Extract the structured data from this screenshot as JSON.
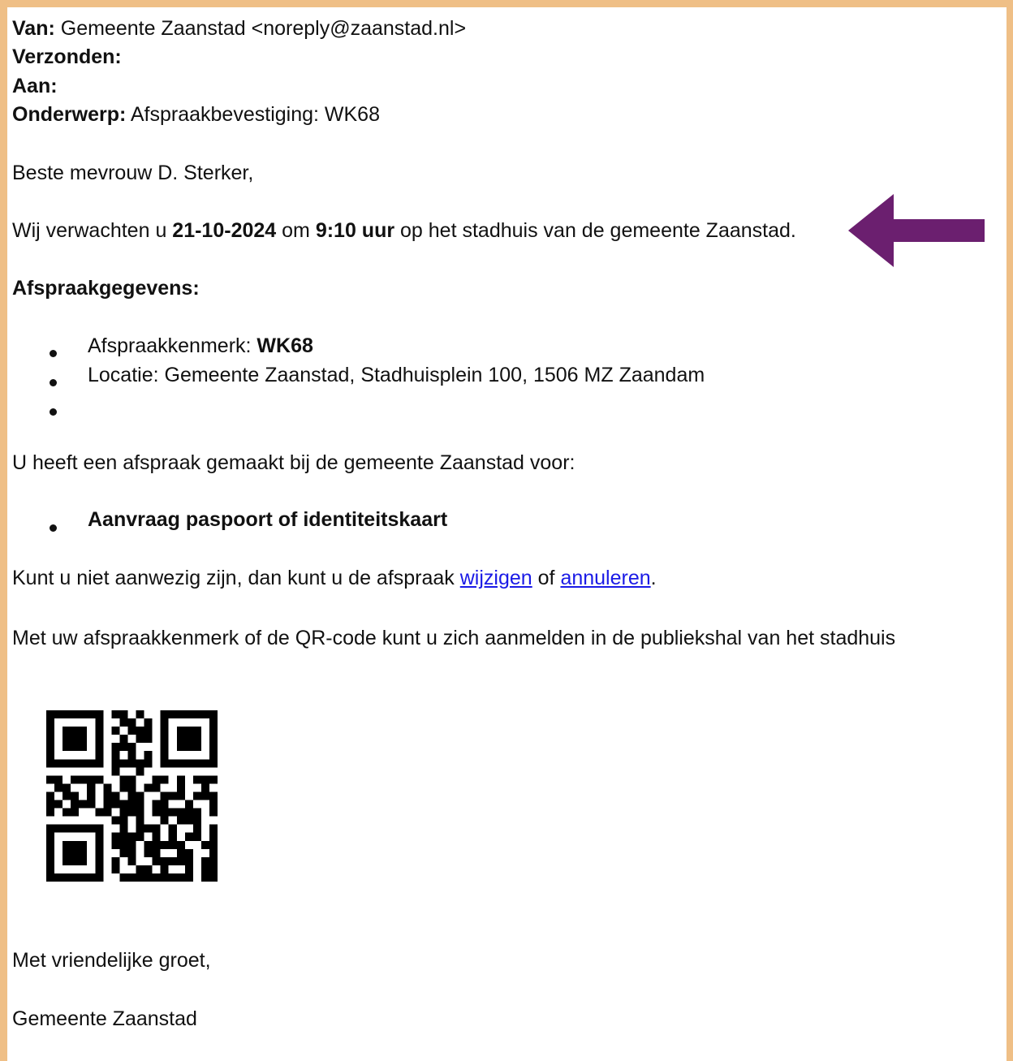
{
  "header": {
    "from_label": "Van:",
    "from_value": "Gemeente Zaanstad <noreply@zaanstad.nl>",
    "sent_label": "Verzonden:",
    "to_label": "Aan:",
    "subject_label": "Onderwerp:",
    "subject_value": "Afspraakbevestiging: WK68"
  },
  "body": {
    "greeting": "Beste mevrouw D. Sterker,",
    "expect_prefix": "Wij verwachten u ",
    "expect_date": "21-10-2024",
    "expect_middle": " om ",
    "expect_time": "9:10 uur",
    "expect_suffix": " op het stadhuis van de gemeente Zaanstad.",
    "details_heading": "Afspraakgegevens:",
    "details": {
      "reference_label": "Afspraakkenmerk: ",
      "reference_value": "WK68",
      "location": "Locatie: Gemeente Zaanstad, Stadhuisplein 100, 1506 MZ Zaandam"
    },
    "appointment_intro": "U heeft een afspraak gemaakt bij de gemeente Zaanstad voor:",
    "appointment_item": "Aanvraag paspoort of identiteitskaart",
    "change_prefix": "Kunt u niet aanwezig zijn, dan kunt u de afspraak ",
    "change_link": "wijzigen",
    "change_middle": " of ",
    "cancel_link": "annuleren",
    "change_suffix": ".",
    "checkin_text": "Met uw afspraakkenmerk of de QR-code kunt u zich aanmelden in de publiekshal van het stadhuis",
    "closing": "Met vriendelijke groet,",
    "signature": "Gemeente Zaanstad"
  },
  "colors": {
    "frame_border": "#efbf86",
    "arrow": "#6b1f6f",
    "link": "#1a1ae6"
  },
  "icons": {
    "arrow": "left-arrow-icon",
    "qr": "qr-code-icon"
  }
}
